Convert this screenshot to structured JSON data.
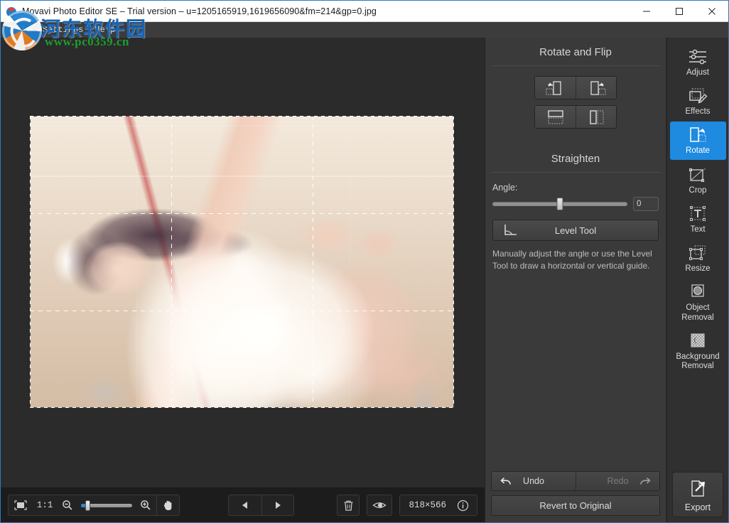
{
  "window": {
    "title": "Movavi Photo Editor SE – Trial version – u=1205165919,1619656090&fm=214&gp=0.jpg",
    "app_icon": "movavi-logo-icon",
    "minimize_label": "—",
    "maximize_label": "▢",
    "close_label": "✕"
  },
  "menubar": {
    "items": [
      {
        "label": "File"
      },
      {
        "label": "Settings"
      },
      {
        "label": "Help"
      }
    ]
  },
  "watermark": {
    "chinese_text": "河东软件园",
    "url_text": "www.pc0359.cn",
    "logo_icon": "site-logo-icon"
  },
  "canvas": {
    "photo_description": "Photo of a person lying on their side in a bathroom, rotated 90 degrees",
    "grid_overlay": "rule-of-thirds",
    "selection_border": "marching-ants"
  },
  "options_panel": {
    "rotate_flip": {
      "title": "Rotate and Flip",
      "buttons": [
        {
          "name": "rotate-left",
          "icon": "rotate-left-icon"
        },
        {
          "name": "rotate-right",
          "icon": "rotate-right-icon"
        },
        {
          "name": "flip-vertical",
          "icon": "flip-vertical-icon"
        },
        {
          "name": "flip-horizontal",
          "icon": "flip-horizontal-icon"
        }
      ]
    },
    "straighten": {
      "title": "Straighten",
      "angle_label": "Angle:",
      "angle_value": "0",
      "angle_slider_percent": 50,
      "level_tool_label": "Level Tool",
      "level_tool_icon": "level-tool-icon",
      "hint": "Manually adjust the angle or use the Level Tool to draw a horizontal or vertical guide."
    },
    "footer": {
      "undo_label": "Undo",
      "undo_icon": "undo-arrow-icon",
      "redo_label": "Redo",
      "redo_icon": "redo-arrow-icon",
      "redo_disabled": true,
      "revert_label": "Revert to Original"
    }
  },
  "tool_sidebar": {
    "accent_color": "#1e8ae0",
    "tools": [
      {
        "label": "Adjust",
        "icon": "sliders-icon",
        "active": false
      },
      {
        "label": "Effects",
        "icon": "effects-icon",
        "active": false
      },
      {
        "label": "Rotate",
        "icon": "rotate-icon",
        "active": true
      },
      {
        "label": "Crop",
        "icon": "crop-icon",
        "active": false
      },
      {
        "label": "Text",
        "icon": "text-icon",
        "active": false
      },
      {
        "label": "Resize",
        "icon": "resize-icon",
        "active": false
      },
      {
        "label": "Object Removal",
        "icon": "object-removal-icon",
        "active": false
      },
      {
        "label": "Background Removal",
        "icon": "background-removal-icon",
        "active": false
      }
    ],
    "export": {
      "label": "Export",
      "icon": "export-icon"
    }
  },
  "bottombar": {
    "fit_icon": "fit-to-screen-icon",
    "ratio_label": "1:1",
    "zoom_out_icon": "zoom-out-icon",
    "zoom_in_icon": "zoom-in-icon",
    "zoom_percent": 8,
    "pan_icon": "hand-pan-icon",
    "prev_icon": "previous-arrow-icon",
    "next_icon": "next-arrow-icon",
    "delete_icon": "trash-icon",
    "compare_icon": "eye-compare-icon",
    "dimensions": "818×566",
    "info_icon": "info-icon"
  }
}
